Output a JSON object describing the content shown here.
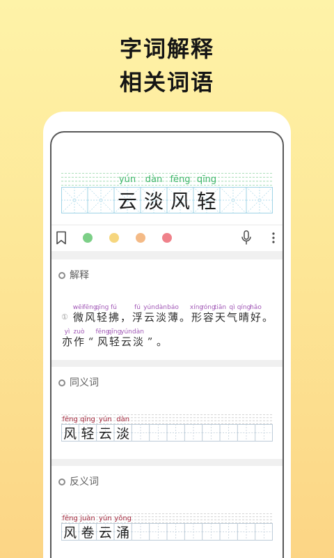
{
  "headline": {
    "line1": "字词解释",
    "line2": "相关词语"
  },
  "word": {
    "pinyin": [
      "yún",
      "dàn",
      "fēng",
      "qīng"
    ],
    "chars": [
      "云",
      "淡",
      "风",
      "轻"
    ]
  },
  "toolbar": {
    "bookmark_icon": "bookmark-icon",
    "highlight_colors": [
      "#7ccf87",
      "#f6d67e",
      "#f4ba86",
      "#ef818a"
    ],
    "mic_icon": "microphone-icon",
    "more_icon": "more-vertical-icon"
  },
  "explanation": {
    "title": "解释",
    "bullet_icon": "circle-bullet-icon",
    "index": "①",
    "lines": [
      [
        {
          "c": "微",
          "p": "wēi"
        },
        {
          "c": "风",
          "p": "fēng"
        },
        {
          "c": "轻",
          "p": "qīng"
        },
        {
          "c": "拂",
          "p": "fú"
        },
        {
          "c": "，",
          "p": ""
        },
        {
          "c": "浮",
          "p": "fú"
        },
        {
          "c": "云",
          "p": "yún"
        },
        {
          "c": "淡",
          "p": "dàn"
        },
        {
          "c": "薄",
          "p": "báo"
        },
        {
          "c": "。",
          "p": ""
        },
        {
          "c": "形",
          "p": "xíng"
        },
        {
          "c": "容",
          "p": "róng"
        },
        {
          "c": "天",
          "p": "tiān"
        },
        {
          "c": "气",
          "p": "qì"
        },
        {
          "c": "晴",
          "p": "qíng"
        },
        {
          "c": "好",
          "p": "hǎo"
        },
        {
          "c": "。",
          "p": ""
        }
      ],
      [
        {
          "c": "亦",
          "p": "yì"
        },
        {
          "c": "作",
          "p": "zuò"
        },
        {
          "c": "“",
          "p": ""
        },
        {
          "c": "风",
          "p": "fēng"
        },
        {
          "c": "轻",
          "p": "qīng"
        },
        {
          "c": "云",
          "p": "yún"
        },
        {
          "c": "淡",
          "p": "dàn"
        },
        {
          "c": "”",
          "p": ""
        },
        {
          "c": "。",
          "p": ""
        }
      ]
    ]
  },
  "synonyms": {
    "title": "同义词",
    "bullet_icon": "circle-bullet-icon",
    "pinyin": [
      "fēng",
      "qīng",
      "yún",
      "dàn"
    ],
    "chars": [
      "风",
      "轻",
      "云",
      "淡"
    ]
  },
  "antonyms": {
    "title": "反义词",
    "bullet_icon": "circle-bullet-icon",
    "pinyin": [
      "fēng",
      "juàn",
      "yún",
      "yǒng"
    ],
    "chars": [
      "风",
      "卷",
      "云",
      "涌"
    ]
  },
  "colors": {
    "background_top": "#fef3a8",
    "background_bottom": "#fcd585",
    "word_pinyin": "#3fb66a",
    "explanation_pinyin": "#a158b6",
    "related_pinyin": "#a3293d",
    "header_grid": "#9fd3e6",
    "header_guide": "#93d6a6",
    "related_grid": "#bccbd8",
    "related_guide": "#c9c9c9"
  }
}
